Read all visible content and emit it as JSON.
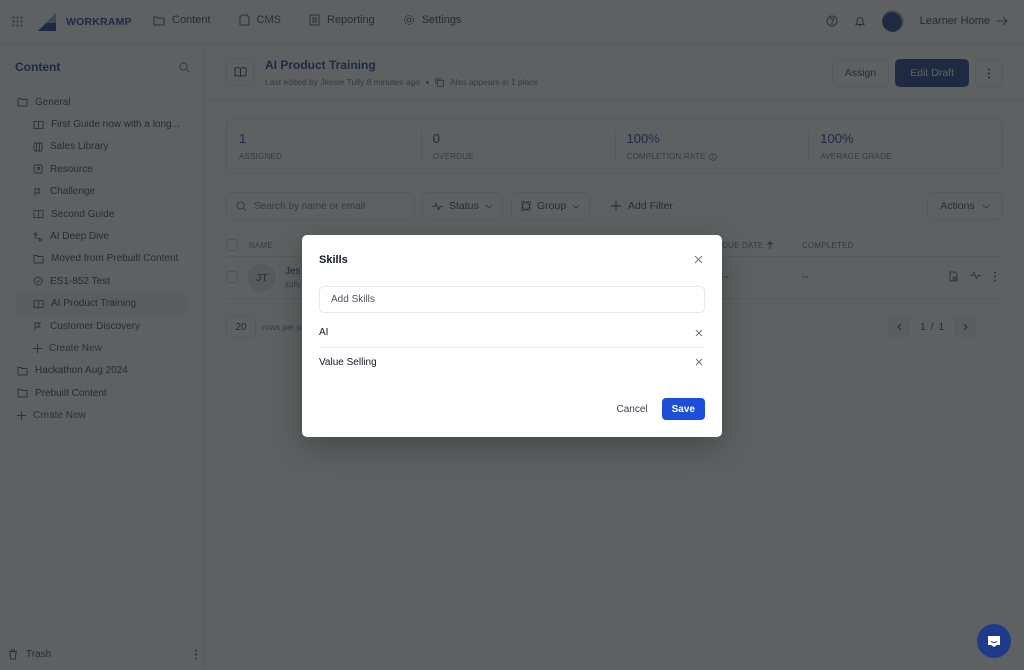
{
  "topnav": {
    "brand": "WORKRAMP",
    "items": [
      {
        "label": "Content",
        "icon": "folder-icon"
      },
      {
        "label": "CMS",
        "icon": "file-icon"
      },
      {
        "label": "Reporting",
        "icon": "report-icon"
      },
      {
        "label": "Settings",
        "icon": "gear-icon"
      }
    ],
    "learner_home": "Learner Home"
  },
  "sidebar": {
    "title": "Content",
    "tree": [
      {
        "label": "General",
        "level": 0,
        "icon": "folder-open-icon"
      },
      {
        "label": "First Guide now with a long...",
        "level": 1,
        "icon": "guide-icon"
      },
      {
        "label": "Sales Library",
        "level": 1,
        "icon": "library-icon"
      },
      {
        "label": "Resource",
        "level": 1,
        "icon": "resource-icon"
      },
      {
        "label": "Challenge",
        "level": 1,
        "icon": "flag-icon"
      },
      {
        "label": "Second Guide",
        "level": 1,
        "icon": "guide-icon"
      },
      {
        "label": "AI Deep Dive",
        "level": 1,
        "icon": "path-icon"
      },
      {
        "label": "Moved from Prebuilt Content",
        "level": 1,
        "icon": "folder-icon"
      },
      {
        "label": "ES1-852 Test",
        "level": 1,
        "icon": "test-icon"
      },
      {
        "label": "AI Product Training",
        "level": 1,
        "icon": "guide-icon",
        "active": true
      },
      {
        "label": "Customer Discovery",
        "level": 1,
        "icon": "flag-icon"
      },
      {
        "label": "Create New",
        "level": 1,
        "icon": "plus-icon",
        "create": true
      },
      {
        "label": "Hackathon Aug 2024",
        "level": 0,
        "icon": "folder-icon"
      },
      {
        "label": "Prebuilt Content",
        "level": 0,
        "icon": "folder-icon"
      },
      {
        "label": "Create New",
        "level": 0,
        "icon": "plus-icon",
        "create": true
      }
    ],
    "trash": "Trash"
  },
  "page": {
    "title": "AI Product Training",
    "last_edited": "Last edited by Jessie Tully 8 minutes ago",
    "appears": "Also appears in 1 place",
    "assign": "Assign",
    "edit_draft": "Edit Draft"
  },
  "stats": [
    {
      "value": "1",
      "label": "ASSIGNED"
    },
    {
      "value": "0",
      "label": "OVERDUE"
    },
    {
      "value": "100%",
      "label": "COMPLETION RATE",
      "info": true
    },
    {
      "value": "100%",
      "label": "AVERAGE GRADE"
    }
  ],
  "toolbar": {
    "search_placeholder": "Search by name or email",
    "status": "Status",
    "group": "Group",
    "add_filter": "Add Filter",
    "actions": "Actions"
  },
  "table": {
    "headers": {
      "name": "NAME",
      "due_date": "DUE DATE",
      "completed": "COMPLETED"
    },
    "rows": [
      {
        "initials": "JT",
        "name": "Jes",
        "email": "jtully",
        "due_date": "--",
        "completed": "--"
      }
    ]
  },
  "pager": {
    "rows_per_page": "20",
    "rows_label": "rows per p",
    "current": "1",
    "separator": "/",
    "total": "1"
  },
  "modal": {
    "title": "Skills",
    "input_placeholder": "Add Skills",
    "skills": [
      "AI",
      "Value Selling"
    ],
    "cancel": "Cancel",
    "save": "Save"
  },
  "colors": {
    "brand": "#1e3a8a",
    "primary_button": "#1d4ed8"
  }
}
